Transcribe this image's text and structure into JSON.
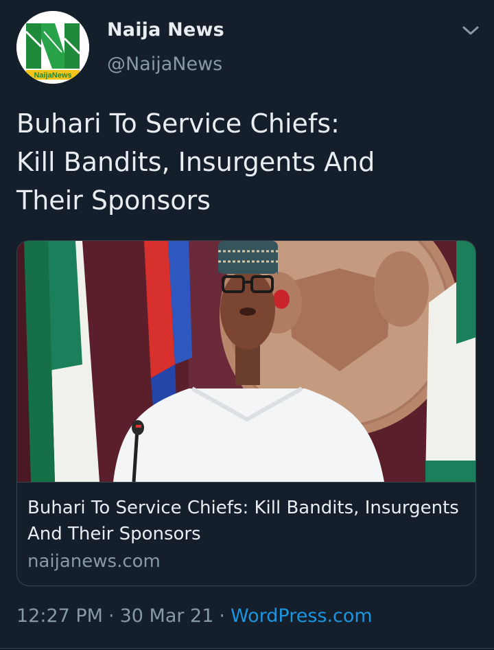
{
  "author": {
    "display_name": "Naija News",
    "handle": "@NaijaNews",
    "avatar_icon": "naija-news-logo",
    "avatar_logo_text": "NaijaNews"
  },
  "tweet": {
    "text_lines": [
      "Buhari To Service Chiefs:",
      "Kill Bandits, Insurgents And",
      "Their Sponsors"
    ]
  },
  "card": {
    "title_lines": [
      "Buhari To Service Chiefs: Kill Bandits, Insurgents",
      "And Their Sponsors"
    ],
    "domain": "naijanews.com"
  },
  "meta": {
    "time": "12:27 PM",
    "date": "30 Mar 21",
    "separator": "·",
    "source": "WordPress.com"
  },
  "icons": {
    "more": "chevron-down-icon"
  },
  "colors": {
    "background": "#151f2b",
    "text_primary": "#e9edf1",
    "text_secondary": "#8899a6",
    "link": "#1b95e0",
    "border": "#38444d"
  }
}
